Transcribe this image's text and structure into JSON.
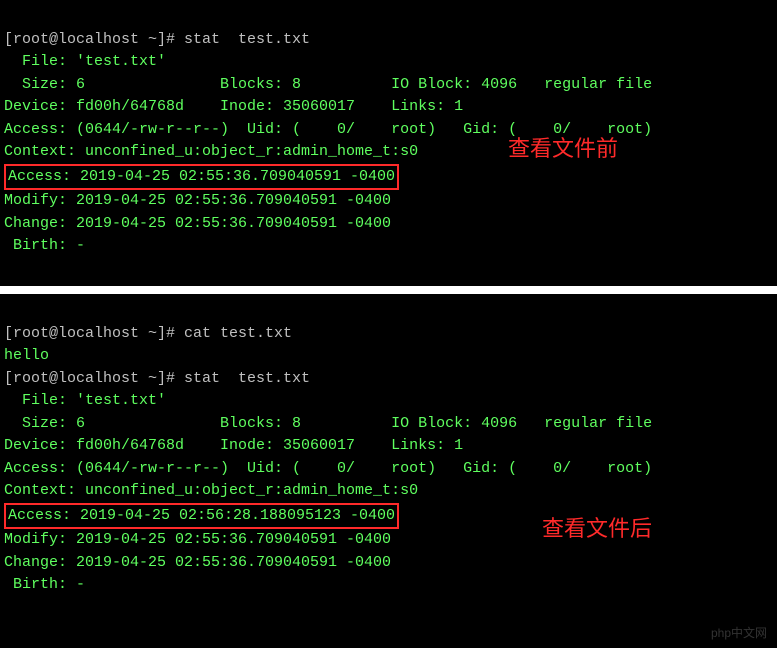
{
  "top": {
    "prompt1": "[root@localhost ~]# ",
    "cmd1": "stat  test.txt",
    "line_file": "  File: 'test.txt'",
    "line_size": "  Size: 6               Blocks: 8          IO Block: 4096   regular file",
    "line_device": "Device: fd00h/64768d    Inode: 35060017    Links: 1",
    "line_access_perm": "Access: (0644/-rw-r--r--)  Uid: (    0/    root)   Gid: (    0/    root)",
    "line_context": "Context: unconfined_u:object_r:admin_home_t:s0",
    "line_access_time": "Access: 2019-04-25 02:55:36.709040591 -0400",
    "line_modify": "Modify: 2019-04-25 02:55:36.709040591 -0400",
    "line_change": "Change: 2019-04-25 02:55:36.709040591 -0400",
    "line_birth": " Birth: -",
    "annotation": "查看文件前"
  },
  "bottom": {
    "prompt1": "[root@localhost ~]# ",
    "cmd1": "cat test.txt",
    "output1": "hello",
    "prompt2": "[root@localhost ~]# ",
    "cmd2": "stat  test.txt",
    "line_file": "  File: 'test.txt'",
    "line_size": "  Size: 6               Blocks: 8          IO Block: 4096   regular file",
    "line_device": "Device: fd00h/64768d    Inode: 35060017    Links: 1",
    "line_access_perm": "Access: (0644/-rw-r--r--)  Uid: (    0/    root)   Gid: (    0/    root)",
    "line_context": "Context: unconfined_u:object_r:admin_home_t:s0",
    "line_access_time": "Access: 2019-04-25 02:56:28.188095123 -0400",
    "line_modify": "Modify: 2019-04-25 02:55:36.709040591 -0400",
    "line_change": "Change: 2019-04-25 02:55:36.709040591 -0400",
    "line_birth": " Birth: -",
    "annotation": "查看文件后",
    "watermark": "php中文网"
  }
}
